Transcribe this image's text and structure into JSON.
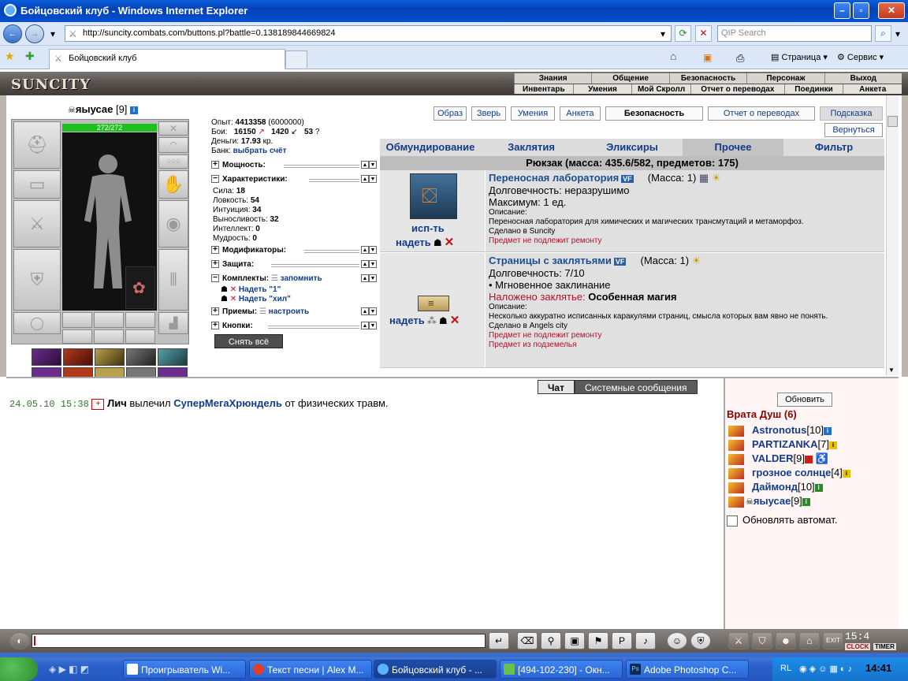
{
  "browser": {
    "title": "Бойцовский клуб - Windows Internet Explorer",
    "url": "http://suncity.combats.com/buttons.pl?battle=0.138189844669824",
    "search_placeholder": "QIP Search",
    "tab_title": "Бойцовский клуб",
    "cmd_page": "Страница",
    "cmd_service": "Сервис"
  },
  "game": {
    "logo": "SUNCITY",
    "menu_top": [
      "Знания",
      "Общение",
      "Безопасность",
      "Персонаж",
      "Выход"
    ],
    "menu_sub": [
      "Инвентарь",
      "Умения",
      "Мой Скролл",
      "Отчет о переводах",
      "Поединки",
      "Анкета"
    ]
  },
  "character": {
    "name": "яыусае",
    "level": "[9]",
    "hp": "272/272",
    "exp_label": "Опыт:",
    "exp": "4413358",
    "exp_next": "(6000000)",
    "fights_label": "Бои:",
    "wins": "16150",
    "losses": "1420",
    "draws": "53",
    "money_label": "Деньги:",
    "money": "17.93",
    "money_unit": "кр.",
    "bank_label": "Банк:",
    "bank_link": "выбрать счёт",
    "sections": {
      "power": "Мощность:",
      "chars": "Характеристики:",
      "mods": "Модификаторы:",
      "defense": "Защита:",
      "sets": "Комплекты:",
      "tricks": "Приемы:",
      "buttons": "Кнопки:"
    },
    "remember": "запомнить",
    "tune": "настроить",
    "stats": [
      {
        "label": "Сила:",
        "value": "18"
      },
      {
        "label": "Ловкость:",
        "value": "54"
      },
      {
        "label": "Интуиция:",
        "value": "34"
      },
      {
        "label": "Выносливость:",
        "value": "32"
      },
      {
        "label": "Интеллект:",
        "value": "0"
      },
      {
        "label": "Мудрость:",
        "value": "0"
      }
    ],
    "sets_list": [
      "Надеть \"1\"",
      "Надеть \"хил\""
    ],
    "takeoff": "Снять всё"
  },
  "inventory": {
    "top_buttons": [
      "Образ",
      "Зверь",
      "Умения",
      "Анкета",
      "Безопасность",
      "Отчет о переводах",
      "Подсказка"
    ],
    "back": "Вернуться",
    "tabs": [
      "Обмундирование",
      "Заклятия",
      "Эликсиры",
      "Прочее",
      "Фильтр"
    ],
    "active_tab": "Прочее",
    "backpack": "Рюкзак (масса: 435.6/582, предметов: 175)",
    "items": [
      {
        "name": "Переносная лаборатория",
        "vf": "VF",
        "mass": "(Масса: 1)",
        "line1": "Долговечность: неразрушимо",
        "line2": "Максимум: 1 ед.",
        "desc_label": "Описание:",
        "desc": "Переносная лаборатория для химических и магических трансмутаций и метаморфоз.",
        "made": "Сделано в Suncity",
        "note": "Предмет не подлежит ремонту",
        "action1": "исп-ть",
        "action2": "надеть"
      },
      {
        "name": "Страницы с заклятьями",
        "vf": "VF",
        "mass": "(Масса: 1)",
        "line1": "Долговечность: 7/10",
        "line2": "• Мгновенное заклинание",
        "spell_label": "Наложено заклятье:",
        "spell": "Особенная магия",
        "desc_label": "Описание:",
        "desc": "Несколько аккуратно исписанных каракулями страниц, смысла которых вам явно не понять.",
        "made": "Сделано в Angels city",
        "note": "Предмет не подлежит ремонту",
        "note2": "Предмет из подземелья",
        "action2": "надеть"
      }
    ]
  },
  "chat": {
    "tab_chat": "Чат",
    "tab_system": "Системные сообщения",
    "message": {
      "time": "24.05.10 15:38",
      "who": "Лич",
      "verb": "вылечил",
      "target": "СуперМегаХрюндель",
      "rest": "от физических травм."
    }
  },
  "online": {
    "refresh": "Обновить",
    "room": "Врата Душ (6)",
    "players": [
      {
        "name": "Astronotus",
        "level": "[10]"
      },
      {
        "name": "PARTIZANKA",
        "level": "[7]"
      },
      {
        "name": "VALDER",
        "level": "[9]"
      },
      {
        "name": "грозное солнце",
        "level": "[4]"
      },
      {
        "name": "Даймонд",
        "level": "[10]"
      },
      {
        "name": "яыусае",
        "level": "[9]"
      }
    ],
    "auto": "Обновлять автомат."
  },
  "toolbar": {
    "clock": "15:4",
    "clock_label": "CLOCK",
    "timer_label": "TIMER"
  },
  "taskbar": {
    "items": [
      "Проигрыватель Wi...",
      "Текст песни | Alex M...",
      "Бойцовский клуб - ...",
      "[494-102-230] - Окн...",
      "Adobe Photoshop C..."
    ],
    "lang": "RL",
    "time": "14:41"
  }
}
